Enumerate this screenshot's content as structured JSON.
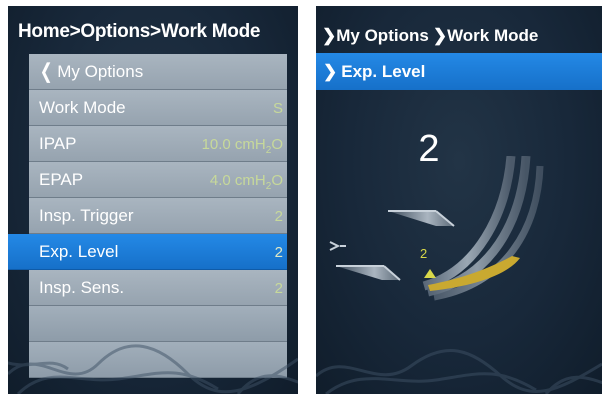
{
  "left_screen": {
    "breadcrumb": "Home>Options>Work Mode",
    "back_label": "My Options",
    "items": [
      {
        "label": "Work Mode",
        "value": "S"
      },
      {
        "label": "IPAP",
        "value": "10.0 cmH2O"
      },
      {
        "label": "EPAP",
        "value": "4.0 cmH2O"
      },
      {
        "label": "Insp. Trigger",
        "value": "2"
      },
      {
        "label": "Exp. Level",
        "value": "2",
        "selected": true
      },
      {
        "label": "Insp. Sens.",
        "value": "2"
      }
    ]
  },
  "right_screen": {
    "path_parent": "My Options",
    "path_current": "Work Mode",
    "selected_item": "Exp. Level",
    "level_value": "2",
    "level_marker": "2"
  },
  "colors": {
    "background": "#18283a",
    "menu_row": "#a9b5c0",
    "selected_row": "#1e7ddb",
    "value_text": "#c7d99a",
    "arc_fill": "#c9a930"
  },
  "icons": {
    "back": "chevron-left-icon",
    "breadcrumb": "chevron-right-icon",
    "lung": "lung-icon"
  }
}
